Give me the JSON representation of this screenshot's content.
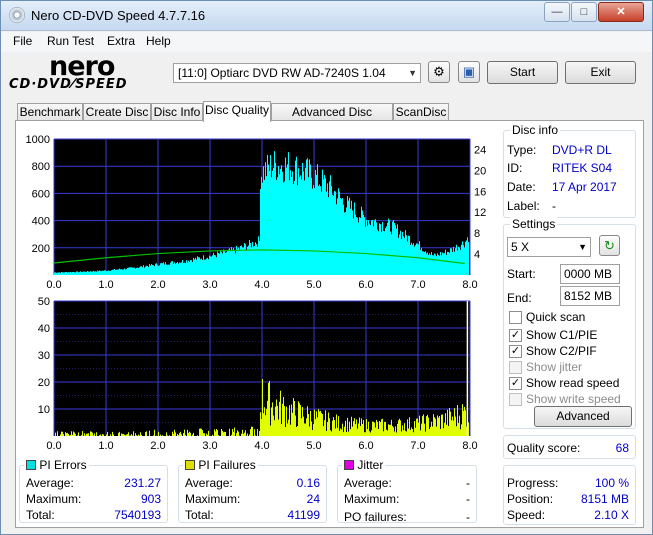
{
  "window": {
    "title": "Nero CD-DVD Speed 4.7.7.16"
  },
  "menu": [
    "File",
    "Run Test",
    "Extra",
    "Help"
  ],
  "logo": {
    "brand": "nero",
    "product": "CD·DVD⁄SPEED"
  },
  "drive": {
    "selected": "[11:0]  Optiarc DVD RW AD-7240S 1.04"
  },
  "buttons": {
    "start": "Start",
    "exit": "Exit",
    "advanced": "Advanced"
  },
  "tabs": [
    "Benchmark",
    "Create Disc",
    "Disc Info",
    "Disc Quality",
    "Advanced Disc Quality",
    "ScanDisc"
  ],
  "active_tab": "Disc Quality",
  "disc_info": {
    "title": "Disc info",
    "type_label": "Type:",
    "type": "DVD+R DL",
    "id_label": "ID:",
    "id": "RITEK S04",
    "date_label": "Date:",
    "date": "17 Apr 2017",
    "label_label": "Label:",
    "label": "-"
  },
  "settings": {
    "title": "Settings",
    "speed": "5 X",
    "start_label": "Start:",
    "start": "0000 MB",
    "end_label": "End:",
    "end": "8152 MB",
    "quick_scan": "Quick scan",
    "show_c1pie": "Show C1/PIE",
    "show_c2pif": "Show C2/PIF",
    "show_jitter": "Show jitter",
    "show_read_speed": "Show read speed",
    "show_write_speed": "Show write speed"
  },
  "checks": {
    "quick_scan": false,
    "show_c1pie": true,
    "show_c2pif": true,
    "show_jitter": false,
    "show_read_speed": true,
    "show_write_speed": false
  },
  "quality": {
    "label": "Quality score:",
    "score": "68"
  },
  "progress": {
    "progress_label": "Progress:",
    "progress": "100 %",
    "position_label": "Position:",
    "position": "8151 MB",
    "speed_label": "Speed:",
    "speed": "2.10 X"
  },
  "pi_errors": {
    "title": "PI Errors",
    "color": "#00e0e0",
    "average_label": "Average:",
    "average": "231.27",
    "maximum_label": "Maximum:",
    "maximum": "903",
    "total_label": "Total:",
    "total": "7540193"
  },
  "pi_failures": {
    "title": "PI Failures",
    "color": "#e0e000",
    "average_label": "Average:",
    "average": "0.16",
    "maximum_label": "Maximum:",
    "maximum": "24",
    "total_label": "Total:",
    "total": "41199"
  },
  "jitter": {
    "title": "Jitter",
    "color": "#e000e0",
    "average_label": "Average:",
    "average": "-",
    "maximum_label": "Maximum:",
    "maximum": "-",
    "po_failures_label": "PO failures:",
    "po_failures": "-"
  },
  "colors": {
    "plot_bg": "#000000",
    "grid": "#3a3ad8",
    "pie": "#00ffff",
    "pif": "#e0ff00",
    "speed_line": "#00c000",
    "read_marker": "#ffffff"
  },
  "chart_data": [
    {
      "type": "area",
      "name": "PI Errors",
      "x_ticks": [
        "0.0",
        "1.0",
        "2.0",
        "3.0",
        "4.0",
        "5.0",
        "6.0",
        "7.0",
        "8.0"
      ],
      "y_ticks": [
        "1000",
        "800",
        "600",
        "400",
        "200"
      ],
      "y2_ticks": [
        "24",
        "20",
        "16",
        "12",
        "8",
        "4"
      ],
      "xlim": [
        0,
        8
      ],
      "ylim": [
        0,
        1000
      ],
      "y2lim": [
        0,
        26
      ],
      "pie_x": [
        0,
        0.5,
        1.0,
        1.5,
        2.0,
        2.5,
        3.0,
        3.5,
        3.95,
        3.96,
        4.2,
        4.5,
        4.8,
        5.0,
        5.3,
        5.6,
        6.0,
        6.5,
        7.0,
        7.3,
        7.6,
        7.9,
        8.0
      ],
      "pie_y": [
        20,
        25,
        35,
        55,
        85,
        110,
        150,
        200,
        270,
        800,
        870,
        860,
        820,
        780,
        690,
        560,
        440,
        380,
        240,
        150,
        190,
        260,
        340
      ],
      "speed_x": [
        0,
        1,
        2,
        3,
        4,
        5,
        6,
        7,
        7.9
      ],
      "speed_y": [
        2.3,
        3.3,
        4.1,
        4.6,
        4.8,
        4.6,
        4.1,
        3.3,
        2.2
      ]
    },
    {
      "type": "bar",
      "name": "PI Failures",
      "x_ticks": [
        "0.0",
        "1.0",
        "2.0",
        "3.0",
        "4.0",
        "5.0",
        "6.0",
        "7.0",
        "8.0"
      ],
      "y_ticks": [
        "50",
        "40",
        "30",
        "20",
        "10"
      ],
      "xlim": [
        0,
        8
      ],
      "ylim": [
        0,
        50
      ],
      "pif_x": [
        0,
        1,
        2,
        3,
        3.95,
        3.96,
        4.2,
        4.5,
        5.0,
        5.5,
        6.0,
        6.5,
        7.0,
        7.5,
        8.0
      ],
      "pif_y": [
        3,
        3,
        4,
        5,
        6,
        22,
        18,
        14,
        10,
        7,
        6,
        6,
        7,
        9,
        14
      ],
      "read_marker_x": 7.95
    }
  ]
}
